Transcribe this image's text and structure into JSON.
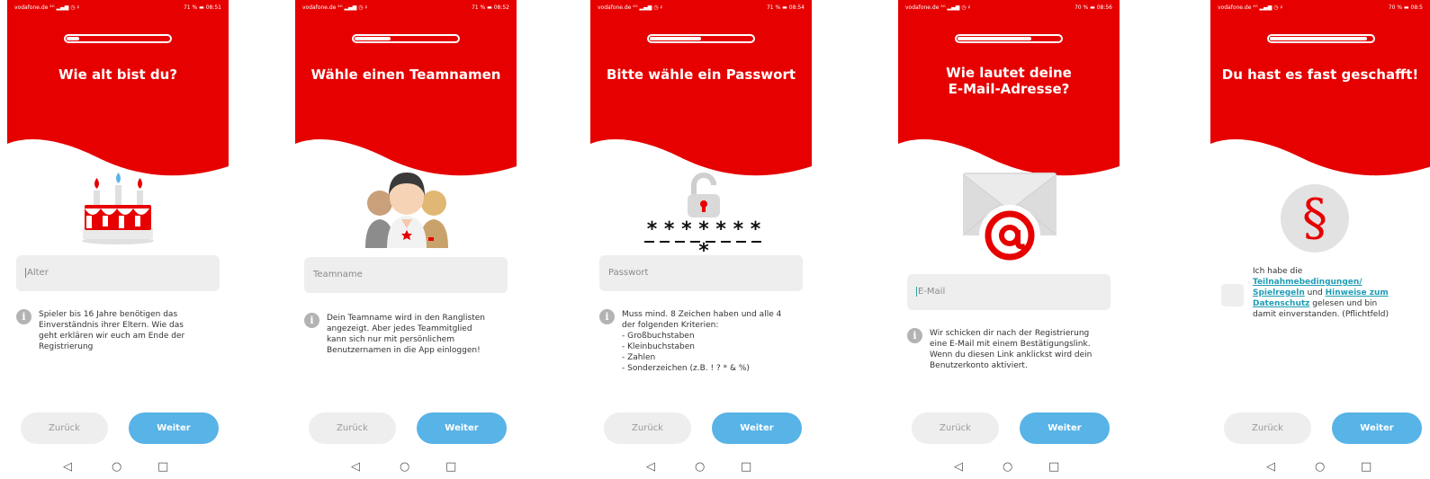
{
  "colors": {
    "brand_red": "#e60000",
    "button_blue": "#58b3e6",
    "input_bg": "#eeeeee",
    "link_teal": "#1f9db5",
    "info_icon": "#b3b3b3"
  },
  "common": {
    "back_label": "Zurück",
    "next_label": "Weiter",
    "nav": {
      "back": "◁",
      "home": "○",
      "recents": "□"
    }
  },
  "screens": [
    {
      "status": {
        "carrier": "vodafone.de ⁴ᴳ ▂▄▆ ◷ ♯",
        "battery_time": "71 % ▬ 08:51"
      },
      "progress_fraction": 0.12,
      "title": "Wie alt bist du?",
      "illustration_icon": "birthday-cake-icon",
      "input_placeholder": "Alter",
      "info_lines": [
        "Spieler bis 16 Jahre benötigen das",
        "Einverständnis ihrer Eltern. Wie das",
        "geht erklären wir euch am Ende der",
        "Registrierung"
      ]
    },
    {
      "status": {
        "carrier": "vodafone.de ⁴ᴳ ▂▄▆ ◷ ♯",
        "battery_time": "71 % ▬ 08:52"
      },
      "progress_fraction": 0.35,
      "title": "Wähle einen Teamnamen",
      "illustration_icon": "team-people-icon",
      "input_placeholder": "Teamname",
      "info_lines": [
        "Dein Teamname wird in den Ranglisten",
        "angezeigt. Aber jedes Teammitglied",
        "kann sich nur mit persönlichem",
        "Benutzernamen in die App einloggen!"
      ]
    },
    {
      "status": {
        "carrier": "vodafone.de ⁴ᴳ ▂▄▆ ◷ ♯",
        "battery_time": "71 % ▬ 08:54"
      },
      "progress_fraction": 0.5,
      "title": "Bitte wähle ein Passwort",
      "illustration_icon": "open-padlock-icon",
      "password_mask": "* * * * * * * *",
      "input_placeholder": "Passwort",
      "info_lines": [
        "Muss mind. 8 Zeichen haben und alle 4",
        "der folgenden Kriterien:",
        "- Großbuchstaben",
        "- Kleinbuchstaben",
        "- Zahlen",
        "- Sonderzeichen (z.B. ! ? * & %)"
      ]
    },
    {
      "status": {
        "carrier": "vodafone.de ⁴ᴳ ▂▄▆ ◷ ♯",
        "battery_time": "70 % ▬ 08:56"
      },
      "progress_fraction": 0.72,
      "title_lines": [
        "Wie lautet deine",
        "E-Mail-Adresse?"
      ],
      "illustration_icon": "email-envelope-at-icon",
      "input_placeholder": "E-Mail",
      "info_lines": [
        "Wir schicken dir nach der Registrierung",
        "eine E-Mail mit einem Bestätigungslink.",
        "Wenn du diesen Link anklickst wird dein",
        "Benutzerkonto aktiviert."
      ]
    },
    {
      "status": {
        "carrier": "vodafone.de ⁴ᴳ ▂▄▆ ◷ ♯",
        "battery_time": "70 % ▬ 08:5"
      },
      "progress_fraction": 0.95,
      "title": "Du hast es fast geschafft!",
      "illustration_icon": "paragraph-sign-icon",
      "paragraph_symbol": "§",
      "consent": {
        "line1": "Ich habe die",
        "link_terms": "Teilnahmebedingungen/",
        "link_rules": "Spielregeln",
        "and": " und ",
        "link_privacy_a": "Hinweise zum",
        "link_privacy_b": "Datenschutz",
        "tail1": " gelesen und bin",
        "tail2": "damit einverstanden. (Pflichtfeld)"
      }
    }
  ]
}
